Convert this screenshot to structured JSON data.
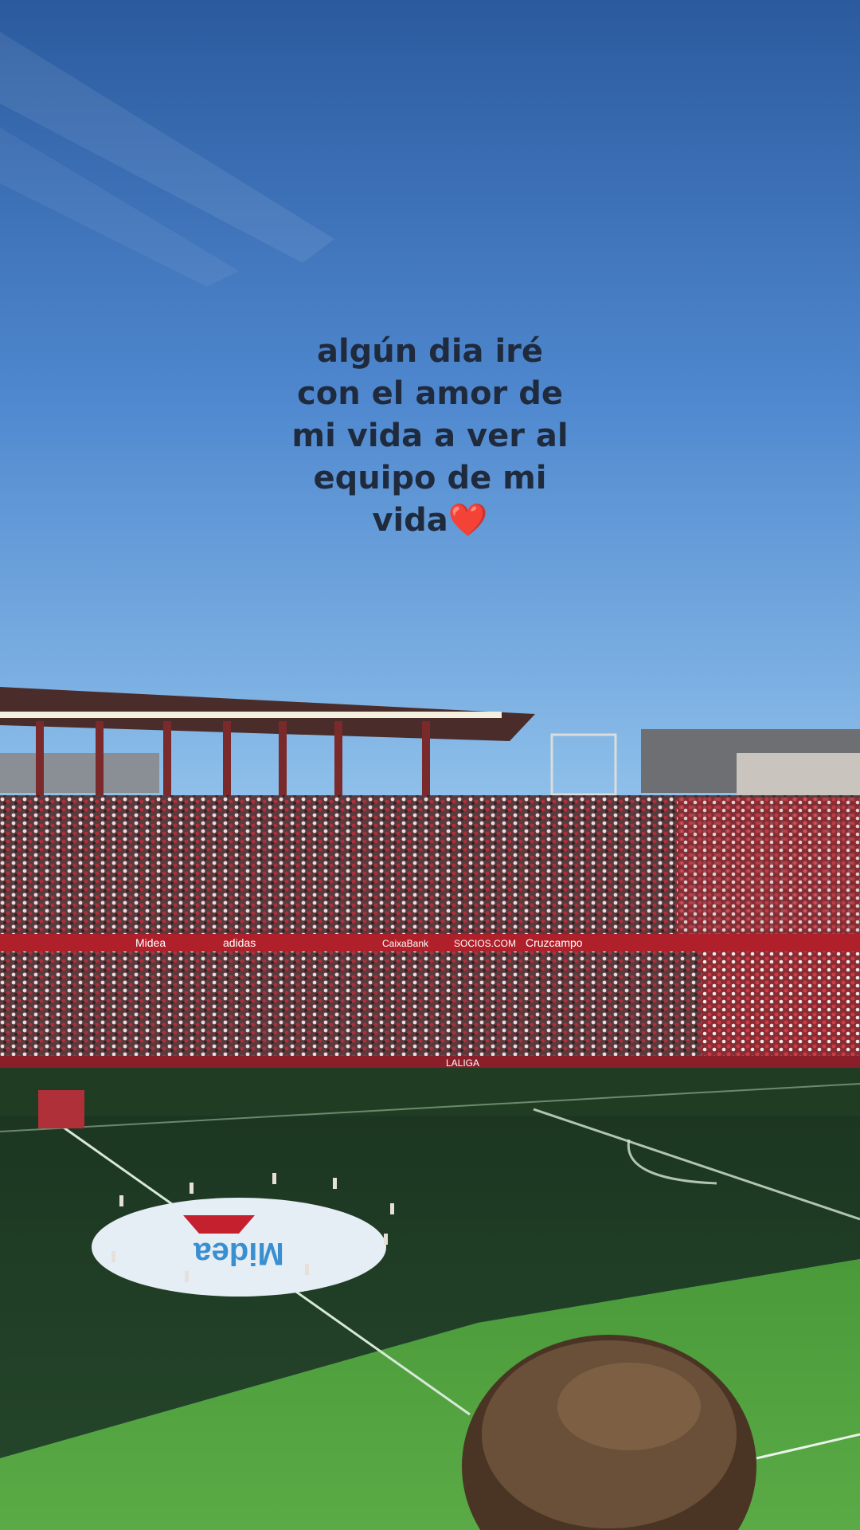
{
  "caption": {
    "text": "algún dia iré\ncon el amor de\nmi vida a ver al\nequipo de mi\nvida",
    "emoji": "❤️"
  },
  "stadium": {
    "sponsor_main": "Midea",
    "boards": [
      "Midea",
      "adidas",
      "CaixaBank",
      "SOCIOS.COM",
      "Cruzcampo",
      "LALIGA"
    ]
  },
  "colors": {
    "sky_top": "#2b5a9e",
    "sky_bottom": "#8ec0ea",
    "pitch_dark": "#1f3d22",
    "pitch_light": "#4f9a3e",
    "crowd_red": "#b0303a"
  }
}
